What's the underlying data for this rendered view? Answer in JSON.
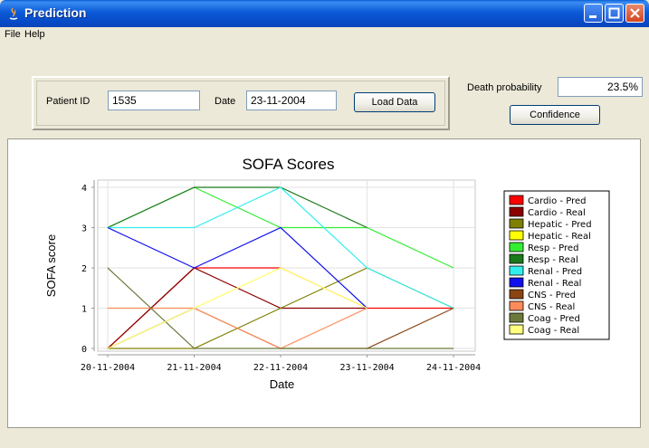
{
  "window": {
    "title": "Prediction"
  },
  "menu": [
    "File",
    "Help"
  ],
  "patient_panel": {
    "patient_id_label": "Patient ID",
    "patient_id_value": "1535",
    "date_label": "Date",
    "date_value": "23-11-2004",
    "load_button": "Load Data"
  },
  "death_panel": {
    "label": "Death probability",
    "value": "23.5%",
    "confidence_button": "Confidence"
  },
  "chart_data": {
    "type": "line",
    "title": "SOFA Scores",
    "xlabel": "Date",
    "ylabel": "SOFA score",
    "categories": [
      "20-11-2004",
      "21-11-2004",
      "22-11-2004",
      "23-11-2004",
      "24-11-2004"
    ],
    "ylim": [
      0,
      4
    ],
    "grid": true,
    "legend_position": "right",
    "series": [
      {
        "name": "Cardio - Pred",
        "color": "#ff0000",
        "points": [
          [
            0,
            0
          ],
          [
            1,
            2
          ],
          [
            2,
            2
          ],
          [
            3,
            1
          ],
          [
            4,
            1
          ]
        ]
      },
      {
        "name": "Cardio - Real",
        "color": "#8b0000",
        "points": [
          [
            0,
            0
          ],
          [
            1,
            2
          ],
          [
            2,
            1
          ],
          [
            3,
            1
          ]
        ]
      },
      {
        "name": "Hepatic - Pred",
        "color": "#808000",
        "points": [
          [
            0,
            0
          ],
          [
            1,
            0
          ],
          [
            2,
            1
          ],
          [
            3,
            2
          ],
          [
            4,
            1
          ]
        ]
      },
      {
        "name": "Hepatic - Real",
        "color": "#ffff00",
        "points": [
          [
            0,
            0
          ],
          [
            1,
            1
          ],
          [
            2,
            2
          ],
          [
            3,
            1
          ]
        ]
      },
      {
        "name": "Resp - Pred",
        "color": "#33ee33",
        "points": [
          [
            0,
            3
          ],
          [
            1,
            4
          ],
          [
            2,
            3
          ],
          [
            3,
            3
          ],
          [
            4,
            2
          ]
        ]
      },
      {
        "name": "Resp - Real",
        "color": "#1a7a1a",
        "points": [
          [
            0,
            3
          ],
          [
            1,
            4
          ],
          [
            2,
            4
          ],
          [
            3,
            3
          ]
        ]
      },
      {
        "name": "Renal - Pred",
        "color": "#33eeee",
        "points": [
          [
            0,
            3
          ],
          [
            1,
            3
          ],
          [
            2,
            4
          ],
          [
            3,
            2
          ],
          [
            4,
            1
          ]
        ]
      },
      {
        "name": "Renal - Real",
        "color": "#1010ee",
        "points": [
          [
            0,
            3
          ],
          [
            1,
            2
          ],
          [
            2,
            3
          ],
          [
            3,
            1
          ]
        ]
      },
      {
        "name": "CNS - Pred",
        "color": "#8b4513",
        "points": [
          [
            0,
            0
          ],
          [
            1,
            1
          ],
          [
            2,
            0
          ],
          [
            3,
            0
          ],
          [
            4,
            1
          ]
        ]
      },
      {
        "name": "CNS - Real",
        "color": "#ff8c5a",
        "points": [
          [
            0,
            1
          ],
          [
            1,
            1
          ],
          [
            2,
            0
          ],
          [
            3,
            1
          ]
        ]
      },
      {
        "name": "Coag - Pred",
        "color": "#6b7a3a",
        "points": [
          [
            0,
            2
          ],
          [
            1,
            0
          ],
          [
            2,
            0
          ],
          [
            3,
            0
          ],
          [
            4,
            0
          ]
        ]
      },
      {
        "name": "Coag - Real",
        "color": "#ffff80",
        "points": [
          [
            0,
            0
          ],
          [
            1,
            1
          ],
          [
            2,
            2
          ],
          [
            3,
            1
          ]
        ]
      }
    ]
  }
}
